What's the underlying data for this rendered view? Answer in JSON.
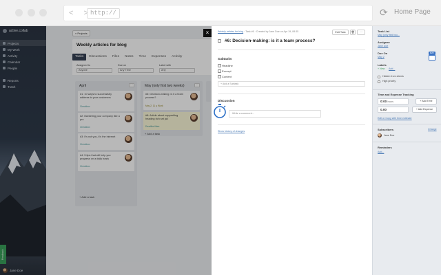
{
  "browser": {
    "url": "http://",
    "nav_arrows": "< >",
    "home_label": "Home Page"
  },
  "sidebar": {
    "workspace": "active.collab",
    "items": [
      {
        "label": "Projects",
        "icon": "folder-icon"
      },
      {
        "label": "My Work",
        "icon": "person-icon"
      },
      {
        "label": "Activity",
        "icon": "activity-icon"
      },
      {
        "label": "Calendar",
        "icon": "calendar-icon"
      },
      {
        "label": "People",
        "icon": "people-icon"
      },
      {
        "label": "Reports",
        "icon": "reports-icon"
      },
      {
        "label": "Trash",
        "icon": "trash-icon"
      }
    ],
    "feedback": "Feedback",
    "user": "Jane Doe"
  },
  "project": {
    "back_label": "« Projects",
    "title": "Weekly articles for blog",
    "tabs": [
      "Tasks",
      "Discussions",
      "Files",
      "Notes",
      "Time",
      "Expenses",
      "Activity"
    ],
    "filters": [
      {
        "label": "Assigned to",
        "value": "Anyone"
      },
      {
        "label": "Due on",
        "value": "Any Time"
      },
      {
        "label": "Label with",
        "value": "Any"
      }
    ],
    "columns": [
      {
        "title": "April",
        "tasks": [
          {
            "text": "#1: 10 ways to successfully address to your customers",
            "label": "Checkbox"
          },
          {
            "text": "#2: Marketing your company like a pro",
            "label": "Checkbox"
          },
          {
            "text": "#3: It's not you, it's the internet",
            "label": "Checkbox"
          },
          {
            "text": "#4: 5 tips that will help you progress on a daily basis",
            "label": "Checkbox"
          }
        ],
        "add_task": "+ Add a task"
      },
      {
        "title": "May (only first two weeks)",
        "tasks": [
          {
            "text": "#6: Decision-making: is it a team process?",
            "label": "May 2, 11 ● Work"
          },
          {
            "text": "#8: Article about copywriting heading rich set jail",
            "label": "Deadline/Idea"
          }
        ],
        "add_task": "+ Add a task"
      }
    ]
  },
  "task": {
    "meta_link": "Weekly articles for blog",
    "meta_text": " · Task #6 · Created by Jane Doe on Apr 19, 08:35",
    "edit_label": "Edit Task",
    "more_label": "···",
    "title": "#6: Decision-making: is it a team process?",
    "subtasks_heading": "Subtasks",
    "subtasks": [
      "Headline",
      "Excerpt",
      "Content"
    ],
    "add_subtask": "+ Add a Subtask",
    "discussion_heading": "Discussion",
    "comment_placeholder": "Write a comment...",
    "history_link": "Show history of changes"
  },
  "details": {
    "task_list_heading": "Task List",
    "task_list_value": "May (only first two...",
    "assignee_heading": "Assignee",
    "assignee_value": "Jane Doe",
    "due_heading": "Due On",
    "due_value": "May 2",
    "due_badge": "MAY",
    "labels_heading": "Labels",
    "labels_value": "+ New",
    "labels_add": "Add...",
    "hidden_from_clients": "Hidden from clients",
    "high_priority": "High priority",
    "time_heading": "Time and Expense Tracking",
    "time_value": "0:00",
    "time_unit": "hours",
    "add_time": "+ Add Time",
    "expense_value": "0.00",
    "add_expense": "+ Add Expense",
    "estimate_link": "Edit or Copy with time estimate",
    "subscribers_heading": "Subscribers",
    "subscribers_change": "Change",
    "subscriber": "Jane Doe",
    "reminders_heading": "Reminders",
    "reminders_add": "Add..."
  },
  "colors": {
    "active_tab": "#364255",
    "link": "#4a7ab5",
    "accent_blue": "#3b73c4",
    "feedback_green": "#3aa05a"
  }
}
